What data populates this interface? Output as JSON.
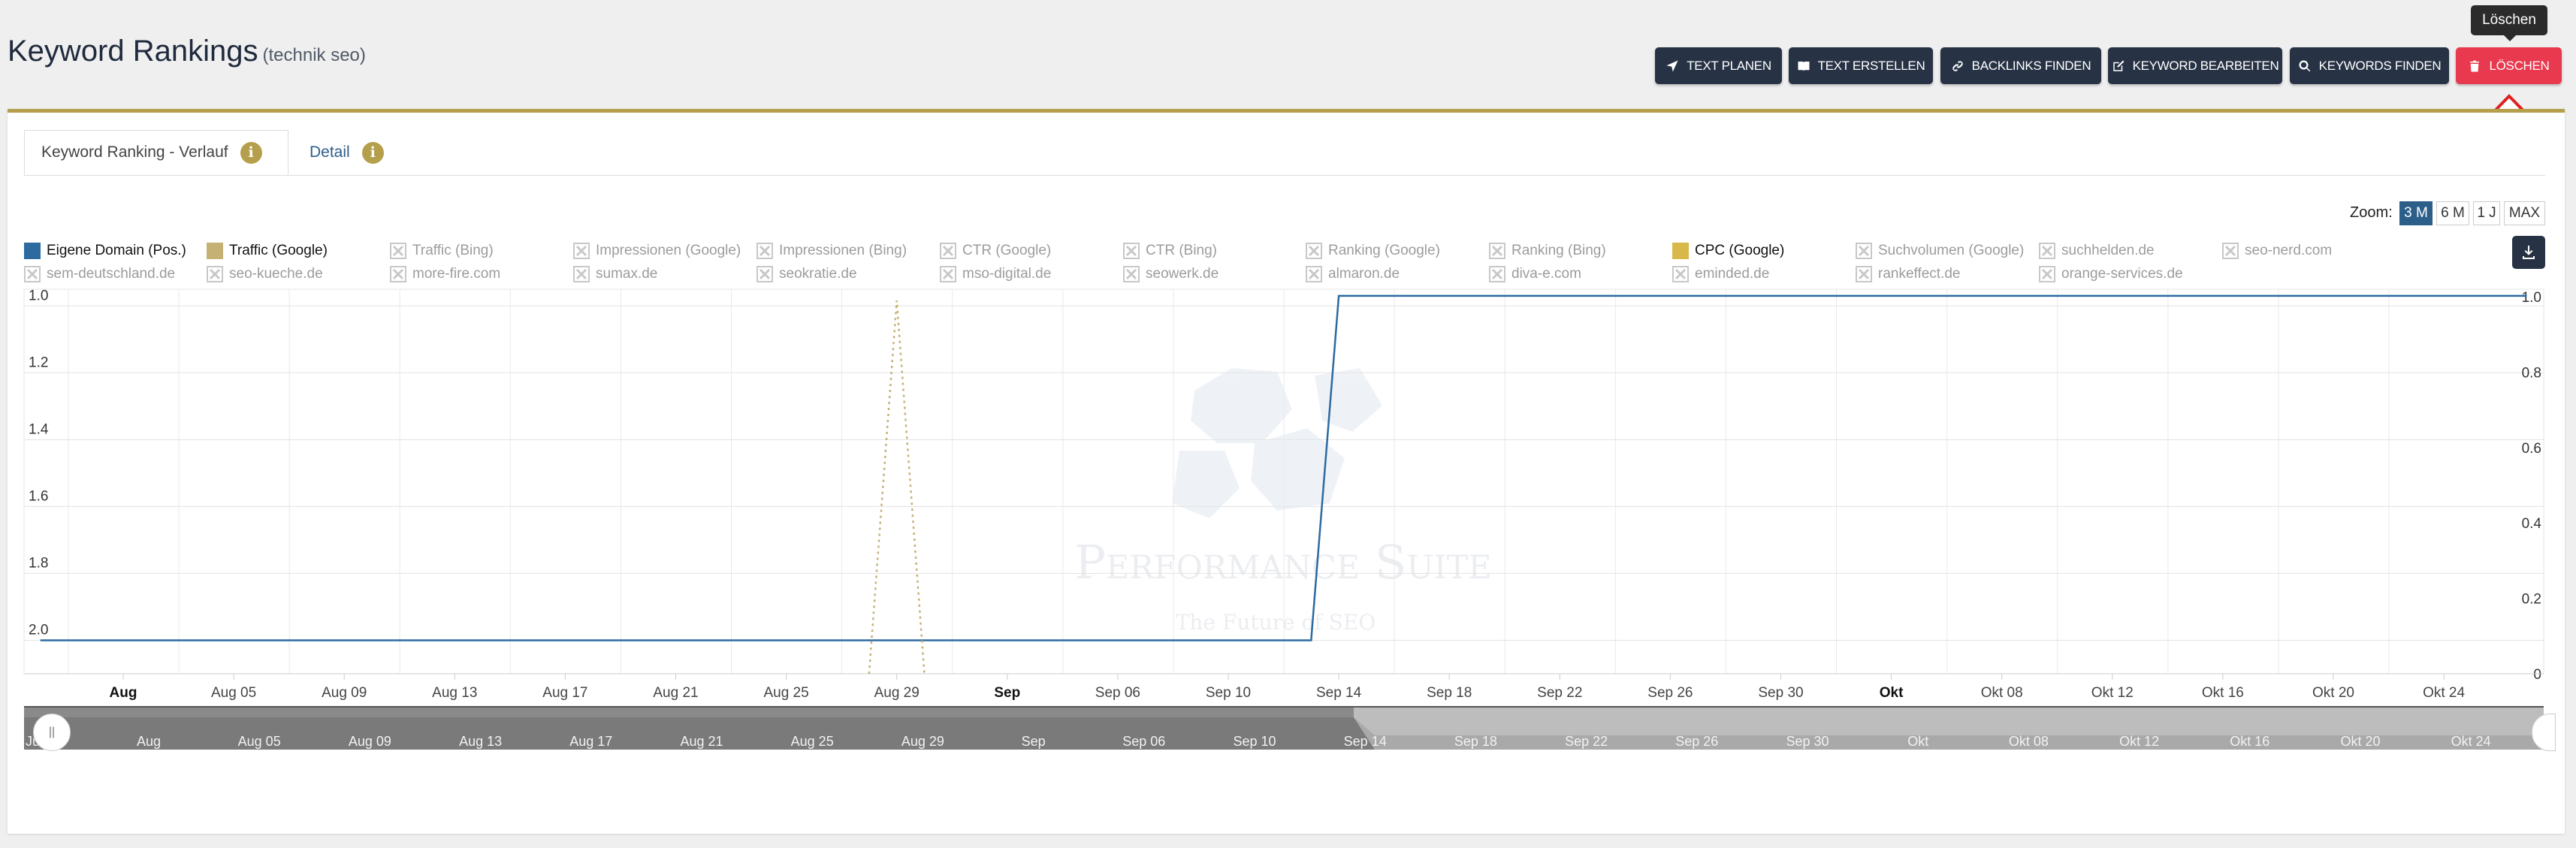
{
  "header": {
    "title": "Keyword Rankings",
    "subtitle": "(technik seo)",
    "buttons": [
      {
        "label": "TEXT PLANEN",
        "icon": "paper-plane-icon"
      },
      {
        "label": "TEXT ERSTELLEN",
        "icon": "book-icon"
      },
      {
        "label": "BACKLINKS FINDEN",
        "icon": "link-icon"
      },
      {
        "label": "KEYWORD BEARBEITEN",
        "icon": "edit-icon"
      },
      {
        "label": "KEYWORDS FINDEN",
        "icon": "search-icon"
      },
      {
        "label": "LÖSCHEN",
        "icon": "trash-icon"
      }
    ],
    "tooltip": "Löschen"
  },
  "tabs": [
    {
      "label": "Keyword Ranking - Verlauf",
      "info": "i"
    },
    {
      "label": "Detail",
      "info": "i"
    }
  ],
  "zoom": {
    "label": "Zoom:",
    "options": [
      "3 M",
      "6 M",
      "1 J",
      "MAX"
    ],
    "selected": "3 M"
  },
  "watermark": {
    "title": "Performance Suite",
    "tagline": "The Future of SEO"
  },
  "legend": [
    {
      "label": "Eigene Domain (Pos.)",
      "active": true,
      "color": "#2c6aa0"
    },
    {
      "label": "Traffic (Google)",
      "active": true,
      "color": "#c4b173"
    },
    {
      "label": "Traffic (Bing)",
      "active": false
    },
    {
      "label": "Impressionen (Google)",
      "active": false
    },
    {
      "label": "Impressionen (Bing)",
      "active": false
    },
    {
      "label": "CTR (Google)",
      "active": false
    },
    {
      "label": "CTR (Bing)",
      "active": false
    },
    {
      "label": "Ranking (Google)",
      "active": false
    },
    {
      "label": "Ranking (Bing)",
      "active": false
    },
    {
      "label": "CPC (Google)",
      "active": true,
      "color": "#d9b84a"
    },
    {
      "label": "Suchvolumen (Google)",
      "active": false
    },
    {
      "label": "suchhelden.de",
      "active": false
    },
    {
      "label": "seo-nerd.com",
      "active": false
    },
    {
      "label": "sem-deutschland.de",
      "active": false
    },
    {
      "label": "seo-kueche.de",
      "active": false
    },
    {
      "label": "more-fire.com",
      "active": false
    },
    {
      "label": "sumax.de",
      "active": false
    },
    {
      "label": "seokratie.de",
      "active": false
    },
    {
      "label": "mso-digital.de",
      "active": false
    },
    {
      "label": "seowerk.de",
      "active": false
    },
    {
      "label": "almaron.de",
      "active": false
    },
    {
      "label": "diva-e.com",
      "active": false
    },
    {
      "label": "eminded.de",
      "active": false
    },
    {
      "label": "rankeffect.de",
      "active": false
    },
    {
      "label": "orange-services.de",
      "active": false
    }
  ],
  "chart_data": {
    "type": "line",
    "x_ticks": [
      {
        "label": "Aug",
        "bold": true
      },
      {
        "label": "Aug 05"
      },
      {
        "label": "Aug 09"
      },
      {
        "label": "Aug 13"
      },
      {
        "label": "Aug 17"
      },
      {
        "label": "Aug 21"
      },
      {
        "label": "Aug 25"
      },
      {
        "label": "Aug 29"
      },
      {
        "label": "Sep",
        "bold": true
      },
      {
        "label": "Sep 06"
      },
      {
        "label": "Sep 10"
      },
      {
        "label": "Sep 14"
      },
      {
        "label": "Sep 18"
      },
      {
        "label": "Sep 22"
      },
      {
        "label": "Sep 26"
      },
      {
        "label": "Sep 30"
      },
      {
        "label": "Okt",
        "bold": true
      },
      {
        "label": "Okt 08"
      },
      {
        "label": "Okt 12"
      },
      {
        "label": "Okt 16"
      },
      {
        "label": "Okt 20"
      },
      {
        "label": "Okt 24"
      }
    ],
    "y_left": {
      "ticks": [
        "1.0",
        "1.2",
        "1.4",
        "1.6",
        "1.8",
        "2.0"
      ],
      "range": [
        2.1,
        0.95
      ],
      "reversed": true
    },
    "y_right": {
      "ticks": [
        "1.0",
        "0.8",
        "0.6",
        "0.4",
        "0.2",
        "0"
      ],
      "range": [
        0,
        1.02
      ]
    },
    "grid": true,
    "series": [
      {
        "name": "Eigene Domain (Pos.)",
        "axis": "left",
        "color": "#2c6aa0",
        "style": "solid",
        "points": [
          [
            "Jul 29",
            2.0
          ],
          [
            "Sep 13",
            2.0
          ],
          [
            "Sep 14",
            0.97
          ],
          [
            "Okt 27",
            0.97
          ]
        ]
      },
      {
        "name": "Traffic (Google)",
        "axis": "right",
        "color": "#c4b173",
        "style": "dotted",
        "points": [
          [
            "Aug 28",
            0
          ],
          [
            "Aug 29",
            0.99
          ],
          [
            "Aug 30",
            0
          ]
        ]
      }
    ],
    "navigator": {
      "labels": [
        "Ju",
        "Aug",
        "Aug 05",
        "Aug 09",
        "Aug 13",
        "Aug 17",
        "Aug 21",
        "Aug 25",
        "Aug 29",
        "Sep",
        "Sep 06",
        "Sep 10",
        "Sep 14",
        "Sep 18",
        "Sep 22",
        "Sep 26",
        "Sep 30",
        "Okt",
        "Okt 08",
        "Okt 12",
        "Okt 16",
        "Okt 20",
        "Okt 24"
      ]
    }
  }
}
